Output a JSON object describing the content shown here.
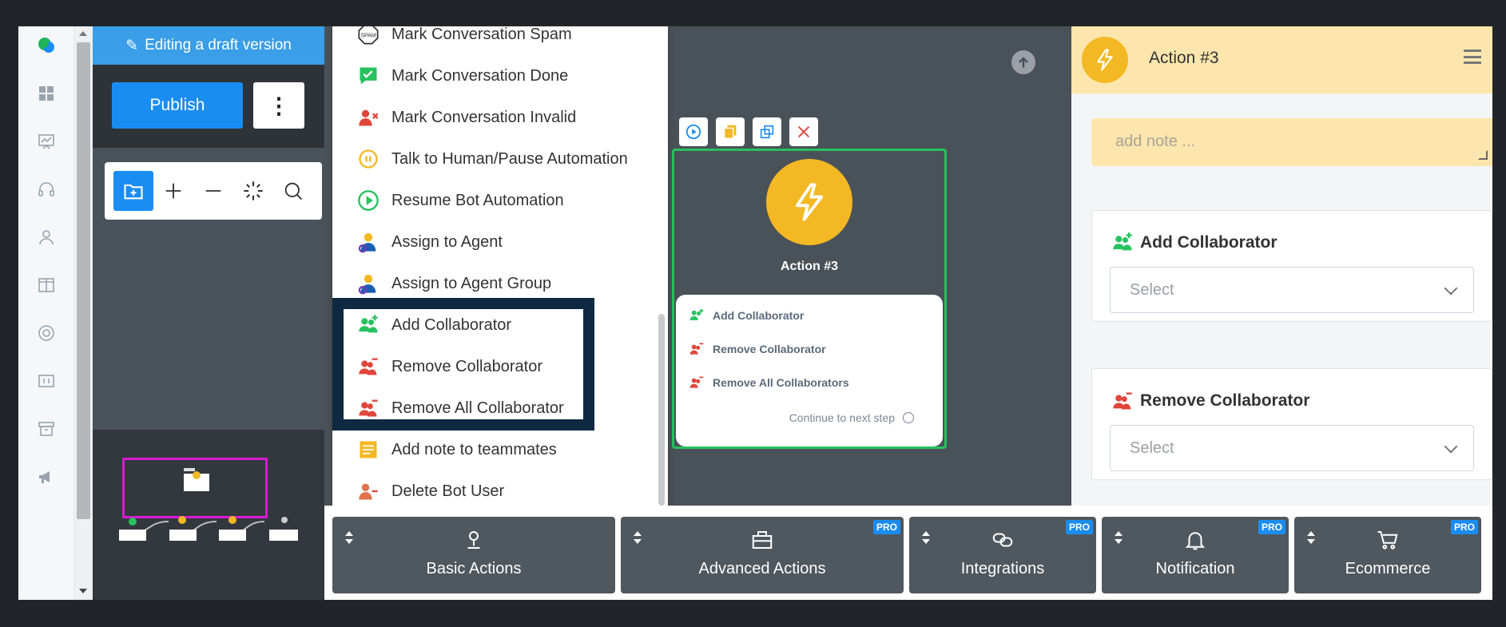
{
  "draft_banner": {
    "label": "Editing a draft version"
  },
  "publish": {
    "label": "Publish",
    "more_label": "⋮"
  },
  "toolbar": {
    "tools": [
      "add-step",
      "zoom-in",
      "zoom-out",
      "auto-arrange",
      "search"
    ]
  },
  "menu": {
    "items": [
      {
        "label": "Mark Conversation Spam",
        "icon": "spam-icon"
      },
      {
        "label": "Mark Conversation Done",
        "icon": "done-icon"
      },
      {
        "label": "Mark Conversation Invalid",
        "icon": "invalid-icon"
      },
      {
        "label": "Talk to Human/Pause Automation",
        "icon": "pause-icon"
      },
      {
        "label": "Resume Bot Automation",
        "icon": "play-icon"
      },
      {
        "label": "Assign to Agent",
        "icon": "agent-icon"
      },
      {
        "label": "Assign to Agent Group",
        "icon": "agent-group-icon"
      },
      {
        "label": "Add Collaborator",
        "icon": "add-collaborator-icon"
      },
      {
        "label": "Remove Collaborator",
        "icon": "remove-collaborator-icon"
      },
      {
        "label": "Remove All Collaborator",
        "icon": "remove-all-collaborators-icon"
      },
      {
        "label": "Add note to teammates",
        "icon": "note-icon"
      },
      {
        "label": "Delete Bot User",
        "icon": "delete-user-icon"
      }
    ]
  },
  "node": {
    "title": "Action #3",
    "rows": [
      "Add Collaborator",
      "Remove Collaborator",
      "Remove All Collaborators"
    ],
    "continue_label": "Continue to next step"
  },
  "right_panel": {
    "title": "Action #3",
    "note_placeholder": "add note ...",
    "sections": [
      {
        "title": "Add Collaborator",
        "select_placeholder": "Select"
      },
      {
        "title": "Remove Collaborator",
        "select_placeholder": "Select"
      }
    ]
  },
  "bottom_tabs": [
    {
      "label": "Basic Actions",
      "pro": ""
    },
    {
      "label": "Advanced Actions",
      "pro": "PRO"
    },
    {
      "label": "Integrations",
      "pro": "PRO"
    },
    {
      "label": "Notification",
      "pro": "PRO"
    },
    {
      "label": "Ecommerce",
      "pro": "PRO"
    }
  ],
  "colors": {
    "accent_blue": "#1a8df2",
    "action_yellow": "#f3b823",
    "node_border_green": "#27c25f",
    "highlight_navy": "#0e2940"
  }
}
